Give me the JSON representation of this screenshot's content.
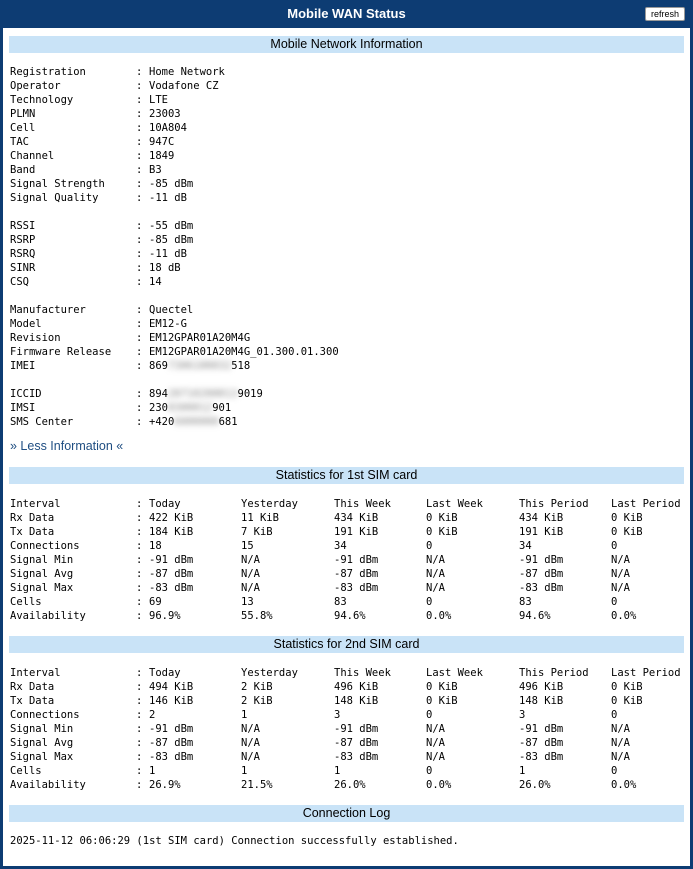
{
  "header": {
    "title": "Mobile WAN Status",
    "refresh_label": "refresh"
  },
  "network": {
    "title": "Mobile Network Information",
    "groups": [
      [
        {
          "k": "Registration",
          "v": "Home Network"
        },
        {
          "k": "Operator",
          "v": "Vodafone CZ"
        },
        {
          "k": "Technology",
          "v": "LTE"
        },
        {
          "k": "PLMN",
          "v": "23003"
        },
        {
          "k": "Cell",
          "v": "10A804"
        },
        {
          "k": "TAC",
          "v": "947C"
        },
        {
          "k": "Channel",
          "v": "1849"
        },
        {
          "k": "Band",
          "v": "B3"
        },
        {
          "k": "Signal Strength",
          "v": "-85 dBm"
        },
        {
          "k": "Signal Quality",
          "v": "-11 dB"
        }
      ],
      [
        {
          "k": "RSSI",
          "v": "-55 dBm"
        },
        {
          "k": "RSRP",
          "v": "-85 dBm"
        },
        {
          "k": "RSRQ",
          "v": "-11 dB"
        },
        {
          "k": "SINR",
          "v": "18 dB"
        },
        {
          "k": "CSQ",
          "v": "14"
        }
      ],
      [
        {
          "k": "Manufacturer",
          "v": "Quectel"
        },
        {
          "k": "Model",
          "v": "EM12-G"
        },
        {
          "k": "Revision",
          "v": "EM12GPAR01A20M4G"
        },
        {
          "k": "Firmware Release",
          "v": "EM12GPAR01A20M4G_01.300.01.300"
        },
        {
          "k": "IMEI",
          "v": "869",
          "blur": "7306100032",
          "v2": "518"
        }
      ],
      [
        {
          "k": "ICCID",
          "v": "894",
          "blur": "20710200013",
          "v2": "9019"
        },
        {
          "k": "IMSI",
          "v": "230",
          "blur": "0300012",
          "v2": "901"
        },
        {
          "k": "SMS Center",
          "v": "+420",
          "blur": "6000000",
          "v2": "681"
        }
      ]
    ],
    "less_label": "» Less Information «"
  },
  "sim1": {
    "title": "Statistics for 1st SIM card",
    "header": [
      "Interval",
      "Today",
      "Yesterday",
      "This Week",
      "Last Week",
      "This Period",
      "Last Period"
    ],
    "rows": [
      [
        "Rx Data",
        "422 KiB",
        "11 KiB",
        "434 KiB",
        "0 KiB",
        "434 KiB",
        "0 KiB"
      ],
      [
        "Tx Data",
        "184 KiB",
        "7 KiB",
        "191 KiB",
        "0 KiB",
        "191 KiB",
        "0 KiB"
      ],
      [
        "Connections",
        "18",
        "15",
        "34",
        "0",
        "34",
        "0"
      ],
      [
        "Signal Min",
        "-91 dBm",
        "N/A",
        "-91 dBm",
        "N/A",
        "-91 dBm",
        "N/A"
      ],
      [
        "Signal Avg",
        "-87 dBm",
        "N/A",
        "-87 dBm",
        "N/A",
        "-87 dBm",
        "N/A"
      ],
      [
        "Signal Max",
        "-83 dBm",
        "N/A",
        "-83 dBm",
        "N/A",
        "-83 dBm",
        "N/A"
      ],
      [
        "Cells",
        "69",
        "13",
        "83",
        "0",
        "83",
        "0"
      ],
      [
        "Availability",
        "96.9%",
        "55.8%",
        "94.6%",
        "0.0%",
        "94.6%",
        "0.0%"
      ]
    ]
  },
  "sim2": {
    "title": "Statistics for 2nd SIM card",
    "header": [
      "Interval",
      "Today",
      "Yesterday",
      "This Week",
      "Last Week",
      "This Period",
      "Last Period"
    ],
    "rows": [
      [
        "Rx Data",
        "494 KiB",
        "2 KiB",
        "496 KiB",
        "0 KiB",
        "496 KiB",
        "0 KiB"
      ],
      [
        "Tx Data",
        "146 KiB",
        "2 KiB",
        "148 KiB",
        "0 KiB",
        "148 KiB",
        "0 KiB"
      ],
      [
        "Connections",
        "2",
        "1",
        "3",
        "0",
        "3",
        "0"
      ],
      [
        "Signal Min",
        "-91 dBm",
        "N/A",
        "-91 dBm",
        "N/A",
        "-91 dBm",
        "N/A"
      ],
      [
        "Signal Avg",
        "-87 dBm",
        "N/A",
        "-87 dBm",
        "N/A",
        "-87 dBm",
        "N/A"
      ],
      [
        "Signal Max",
        "-83 dBm",
        "N/A",
        "-83 dBm",
        "N/A",
        "-83 dBm",
        "N/A"
      ],
      [
        "Cells",
        "1",
        "1",
        "1",
        "0",
        "1",
        "0"
      ],
      [
        "Availability",
        "26.9%",
        "21.5%",
        "26.0%",
        "0.0%",
        "26.0%",
        "0.0%"
      ]
    ]
  },
  "log": {
    "title": "Connection Log",
    "entries": [
      "2025-11-12 06:06:29 (1st SIM card) Connection successfully established."
    ]
  }
}
